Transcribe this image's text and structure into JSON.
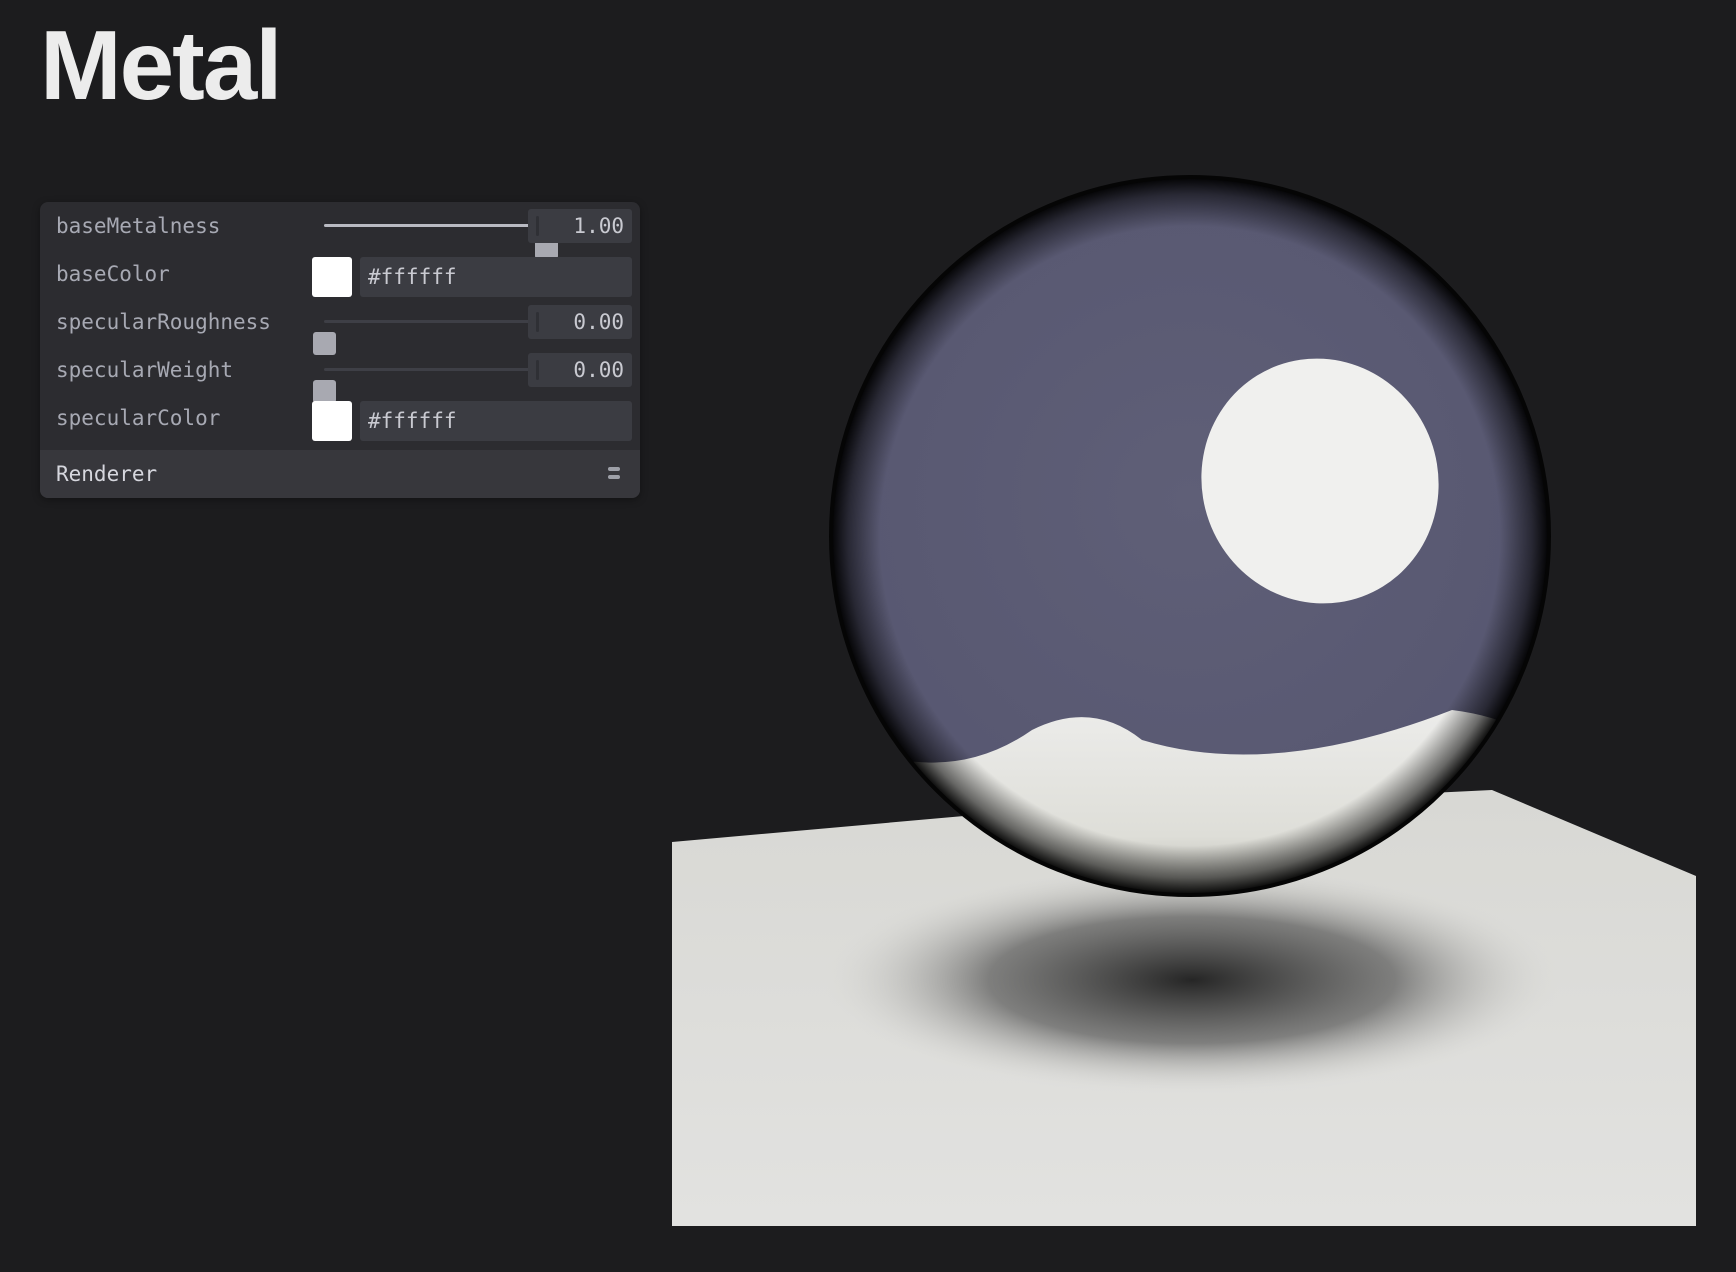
{
  "page": {
    "title": "Metal"
  },
  "pane": {
    "rows": [
      {
        "label": "baseMetalness",
        "type": "slider",
        "value": 1.0,
        "display": "1.00"
      },
      {
        "label": "baseColor",
        "type": "color",
        "value": "#ffffff"
      },
      {
        "label": "specularRoughness",
        "type": "slider",
        "value": 0.0,
        "display": "0.00"
      },
      {
        "label": "specularWeight",
        "type": "slider",
        "value": 0.0,
        "display": "0.00"
      },
      {
        "label": "specularColor",
        "type": "color",
        "value": "#ffffff"
      }
    ],
    "folder": {
      "title": "Renderer",
      "collapsed": true
    }
  },
  "colors": {
    "background": "#1c1c1e",
    "sphere_reflection": "#5d5d74",
    "floor": "#e0e0de",
    "highlight": "#f0f0ee"
  }
}
